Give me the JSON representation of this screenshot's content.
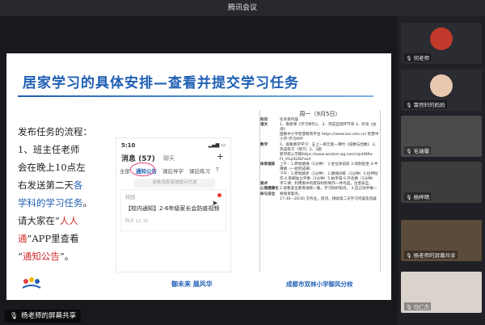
{
  "window": {
    "title": "腾讯会议"
  },
  "slide": {
    "title": "居家学习的具体安排—查看并提交学习任务",
    "steps": {
      "line1": "发布任务的流程：",
      "line2": "1、班主任老师",
      "line3": "会在晚上10点左",
      "line4a": "右发送第二天",
      "line4b": "各",
      "line5": "学科的学习任务",
      "line5b": "。",
      "line6a": "请大家在“",
      "line6b": "人人",
      "line7a": "通",
      "line7b": "”APP里查看",
      "line8a": "“",
      "line8b": "通知公告",
      "line8c": "”。"
    },
    "phone": {
      "time": "5:10",
      "signal": "▂▄▆ ▭",
      "header": "消息 (57)",
      "header2": "聊天",
      "plus": "+",
      "tabs": [
        "全部",
        "通知公告",
        "课后导学",
        "课后练习",
        "T"
      ],
      "note": "该条消息有效提示已读",
      "card_who": "校园",
      "card_msg": "【校内通知】2-6年级家长会防疫视频",
      "card_time": "昨天 12:32"
    },
    "doc": {
      "heading": "周一（9月5日）",
      "rows": [
        {
          "k": "科目",
          "v": "任务单内容"
        },
        {
          "k": "语文",
          "v": "1、看新课《学习导引》。 2、完成自测环节单 3、听读《古诗》"
        },
        {
          "k": "",
          "v": "国家中小学智慧教育平台 https://www.zxx.edu.cn/ 智慧中小学-学习APP"
        },
        {
          "k": "数学",
          "v": "1、观看教学学习：五上一单元第一课时《倍数与因数》 2、完成练习（预习）2、3题"
        },
        {
          "k": "",
          "v": "新学校心学期https://www.wisdom.qq.com/s/p4IN9e-Ft_VGpIGZbFxeA"
        },
        {
          "k": "体育锻炼",
          "v": "上午：1.原地跳绳（1分钟） 2.坐位体前屈 3.仰卧起坐 4.半蹲跳（一组完成来）"
        },
        {
          "k": "",
          "v": "下午：1.原地踏步（1分钟） 2.跳绳训练（1分钟）3.拉伸动作 4.单脚站立平衡（1分钟）5.拍手操 6.开合跳（1分钟）"
        },
        {
          "k": "美术",
          "v": "手工课：利用家中的废旧材料制作一件作品，注意安全。"
        },
        {
          "k": "心理健康生命与安全",
          "v": "2.观看安全教育视频一集，学习防护知识。 3.自己动手做一顿简单家务。"
        },
        {
          "k": "",
          "v": "17:30—20:00 交作业，提问，接收第二天学习内容及答疑"
        }
      ]
    },
    "footer_left": "御未来 展风华",
    "footer_right": "成都市双林小学御风分校"
  },
  "share_tag": "杨老师的屏幕共享",
  "participants": [
    {
      "name": "何老师",
      "kind": "avatar",
      "color": "#c0392b"
    },
    {
      "name": "霏然轩的妈妈",
      "kind": "avatar",
      "color": "#e8c9b0"
    },
    {
      "name": "毛瑞馨",
      "kind": "photo",
      "color": "#4a4a4a"
    },
    {
      "name": "杨梓晴",
      "kind": "photo",
      "color": "#3d3d3d"
    },
    {
      "name": "杨老师的屏幕共享",
      "kind": "photo",
      "color": "#5a4b3a"
    },
    {
      "name": "马仁杰",
      "kind": "photo",
      "color": "#d9d3cc"
    }
  ]
}
